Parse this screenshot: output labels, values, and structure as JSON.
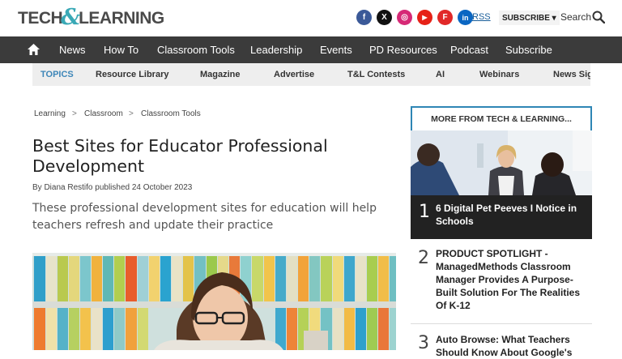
{
  "header": {
    "logo_part1": "TECH",
    "logo_amp": "&",
    "logo_part2": "LEARNING",
    "rss": "RSS",
    "subscribe": "SUBSCRIBE ▾",
    "search": "Search"
  },
  "socials": [
    {
      "icon": "facebook-icon",
      "glyph": "f",
      "color": "#3b5998"
    },
    {
      "icon": "x-icon",
      "glyph": "X",
      "color": "#111111"
    },
    {
      "icon": "instagram-icon",
      "glyph": "◎",
      "color": "#d62976"
    },
    {
      "icon": "youtube-icon",
      "glyph": "▶",
      "color": "#e62117"
    },
    {
      "icon": "flipboard-icon",
      "glyph": "F",
      "color": "#e12828"
    },
    {
      "icon": "linkedin-icon",
      "glyph": "in",
      "color": "#0a66c2"
    }
  ],
  "nav": {
    "items": [
      "News",
      "How To",
      "Classroom Tools",
      "Leadership",
      "Events",
      "PD Resources",
      "Podcast",
      "Subscribe"
    ]
  },
  "topics": {
    "label": "TOPICS",
    "items": [
      "Resource Library",
      "Magazine",
      "Advertise",
      "T&L Contests",
      "AI",
      "Webinars",
      "News Sig"
    ]
  },
  "breadcrumb": {
    "items": [
      "Learning",
      "Classroom",
      "Classroom Tools"
    ],
    "separator": ">"
  },
  "article": {
    "title": "Best Sites for Educator Professional Development",
    "byline": "By Diana Restifo published 24 October 2023",
    "strapline": "These professional development sites for education will help teachers refresh and update their practice"
  },
  "sidebar": {
    "header": "MORE FROM TECH & LEARNING...",
    "items": [
      {
        "num": "1",
        "text": "6 Digital Pet Peeves I Notice in Schools"
      },
      {
        "num": "2",
        "text": "PRODUCT SPOTLIGHT - ManagedMethods Classroom Manager Provides A Purpose-Built Solution For The Realities Of K-12"
      },
      {
        "num": "3",
        "text": "Auto Browse: What Teachers Should Know About Google's"
      }
    ]
  }
}
